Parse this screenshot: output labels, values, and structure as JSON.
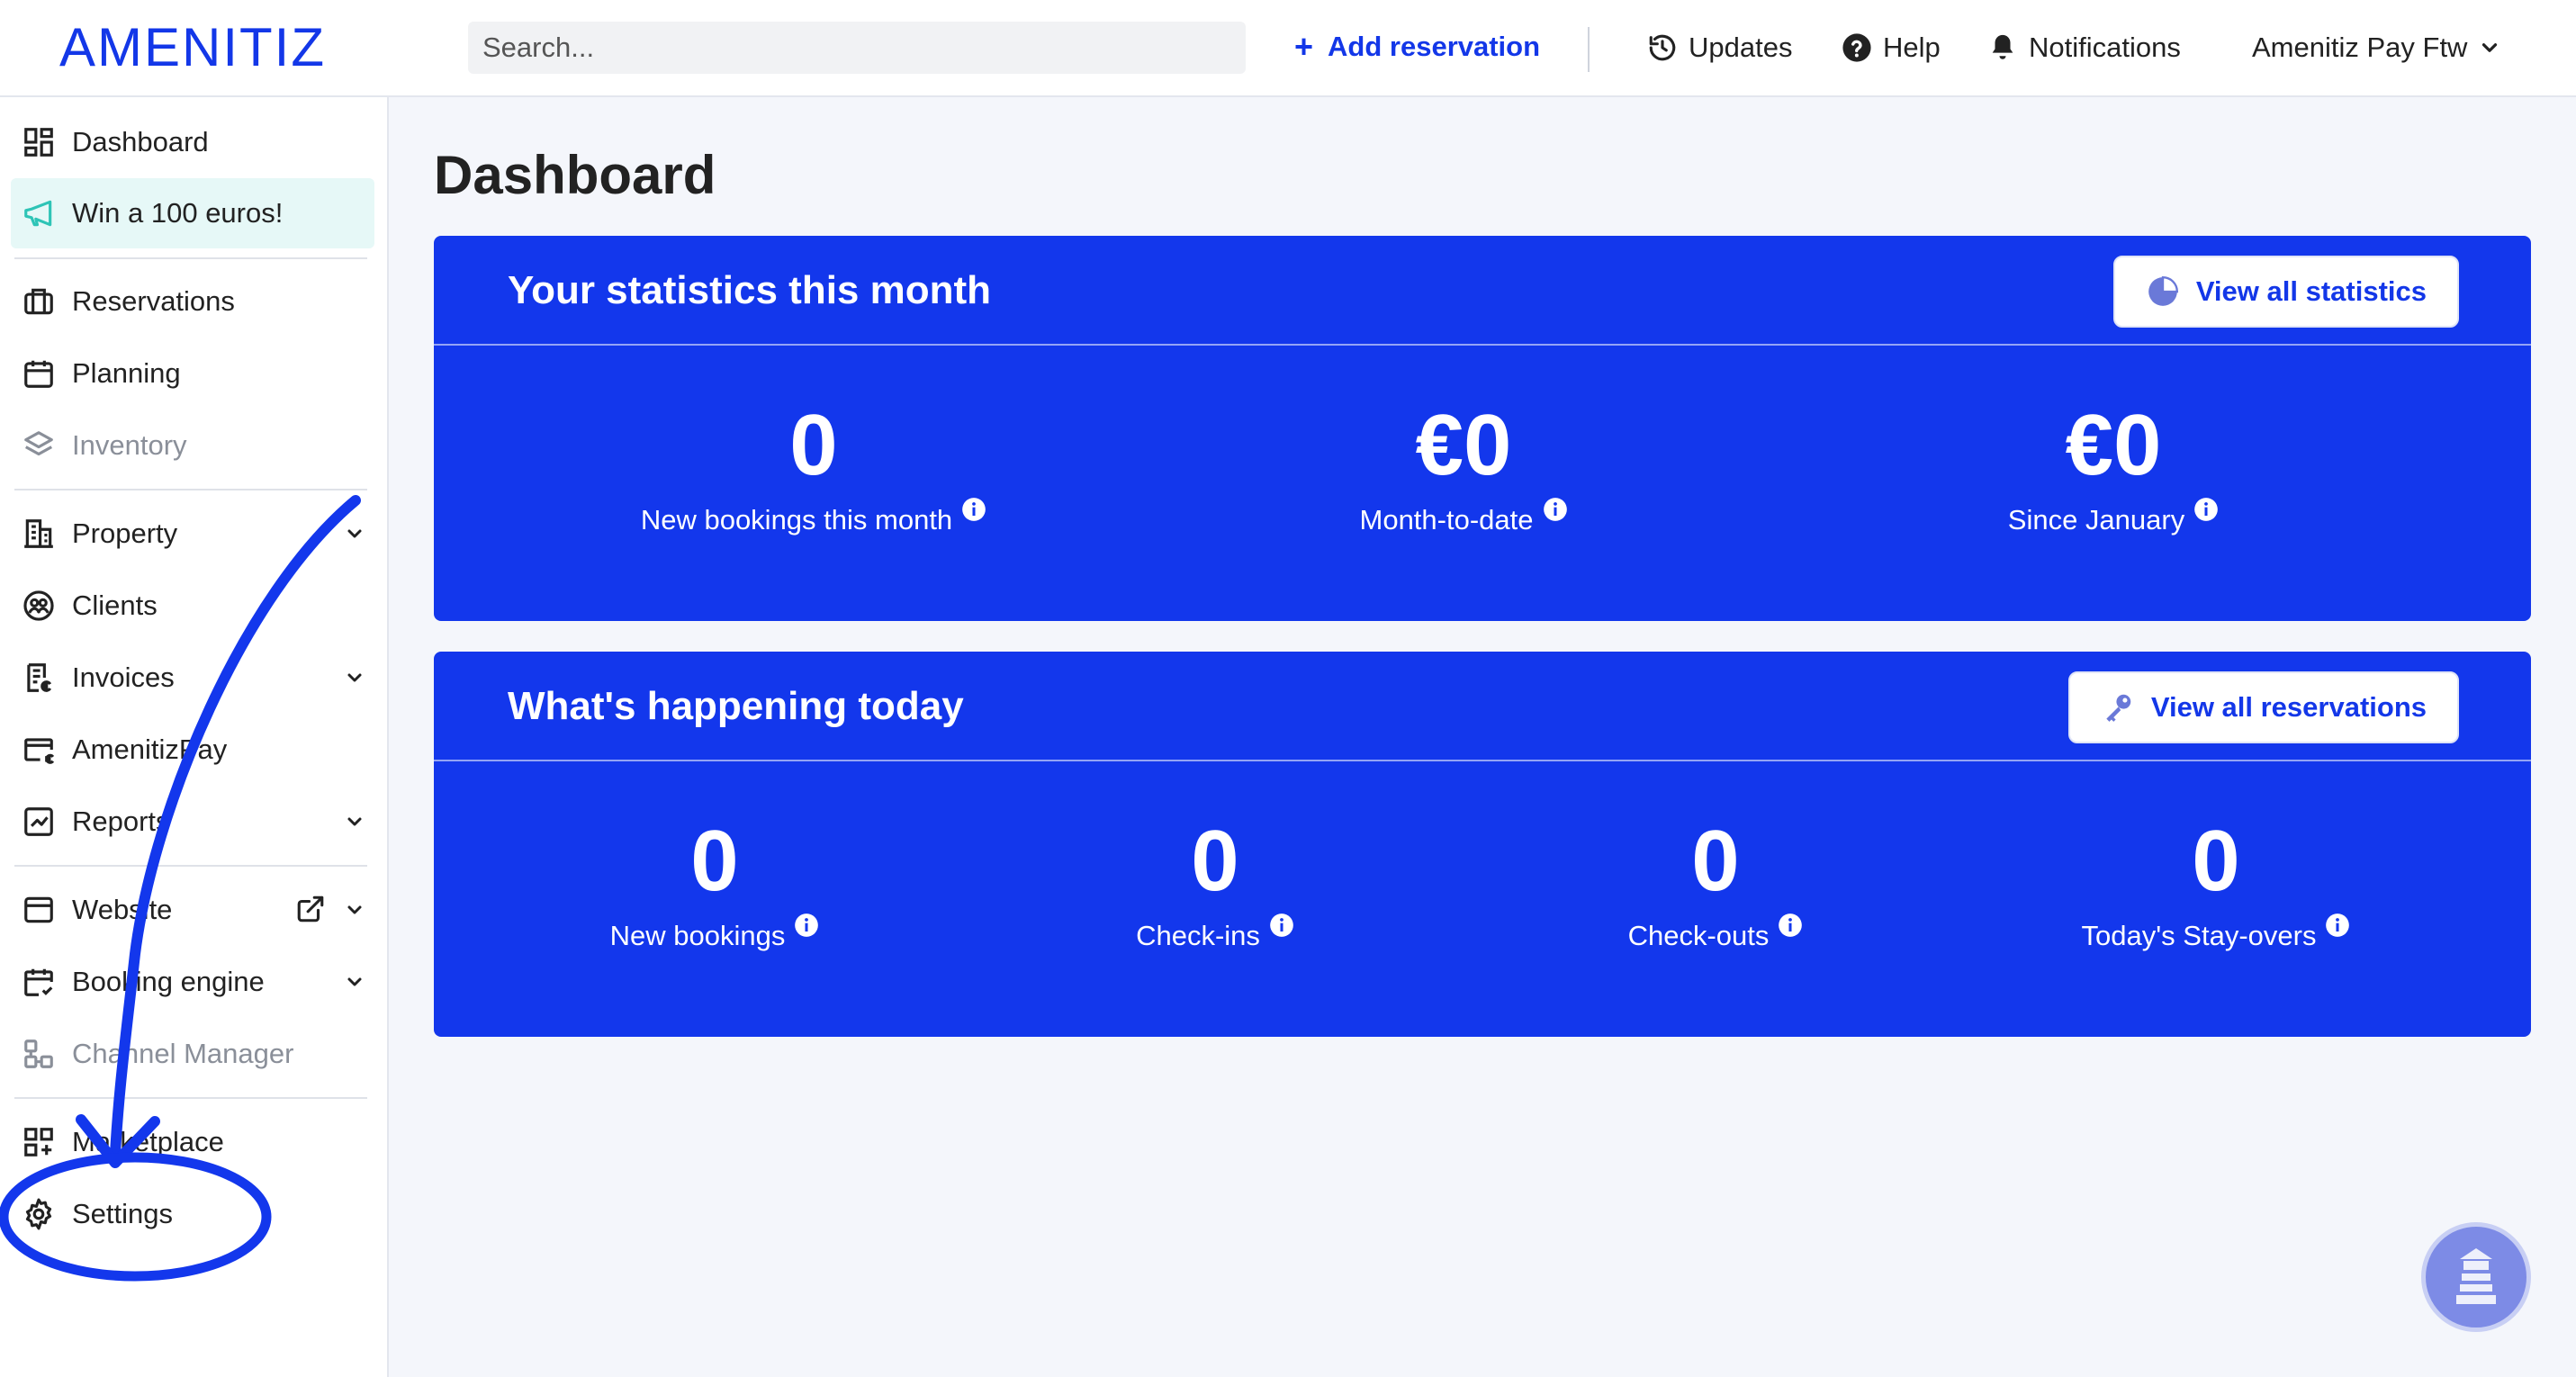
{
  "header": {
    "logo": "AMENITIZ",
    "search_placeholder": "Search...",
    "add_reservation": "Add reservation",
    "updates": "Updates",
    "help": "Help",
    "notifications": "Notifications",
    "account": "Amenitiz Pay Ftw"
  },
  "sidebar": {
    "items": [
      {
        "label": "Dashboard",
        "icon": "dashboard-icon"
      },
      {
        "label": "Win a 100 euros!",
        "icon": "megaphone-icon"
      },
      {
        "label": "Reservations",
        "icon": "suitcase-icon"
      },
      {
        "label": "Planning",
        "icon": "calendar-icon"
      },
      {
        "label": "Inventory",
        "icon": "layers-icon"
      },
      {
        "label": "Property",
        "icon": "building-icon"
      },
      {
        "label": "Clients",
        "icon": "clients-icon"
      },
      {
        "label": "Invoices",
        "icon": "invoice-icon"
      },
      {
        "label": "AmenitizPay",
        "icon": "card-euro-icon"
      },
      {
        "label": "Reports",
        "icon": "chart-icon"
      },
      {
        "label": "Website",
        "icon": "browser-icon"
      },
      {
        "label": "Booking engine",
        "icon": "calendar-check-icon"
      },
      {
        "label": "Channel Manager",
        "icon": "channels-icon"
      },
      {
        "label": "Marketplace",
        "icon": "grid-plus-icon"
      },
      {
        "label": "Settings",
        "icon": "gear-icon"
      }
    ]
  },
  "main": {
    "title": "Dashboard",
    "stats_card": {
      "title": "Your statistics this month",
      "button": "View all statistics",
      "metrics": [
        {
          "value": "0",
          "label": "New bookings this month"
        },
        {
          "value": "€0",
          "label": "Month-to-date"
        },
        {
          "value": "€0",
          "label": "Since January"
        }
      ]
    },
    "today_card": {
      "title": "What's happening today",
      "button": "View all reservations",
      "metrics": [
        {
          "value": "0",
          "label": "New bookings"
        },
        {
          "value": "0",
          "label": "Check-ins"
        },
        {
          "value": "0",
          "label": "Check-outs"
        },
        {
          "value": "0",
          "label": "Today's Stay-overs"
        }
      ]
    }
  },
  "colors": {
    "brand": "#1337e8",
    "card_bg": "#1337ec",
    "promo_bg": "#e6f8f7",
    "annotation": "#1337ec"
  }
}
